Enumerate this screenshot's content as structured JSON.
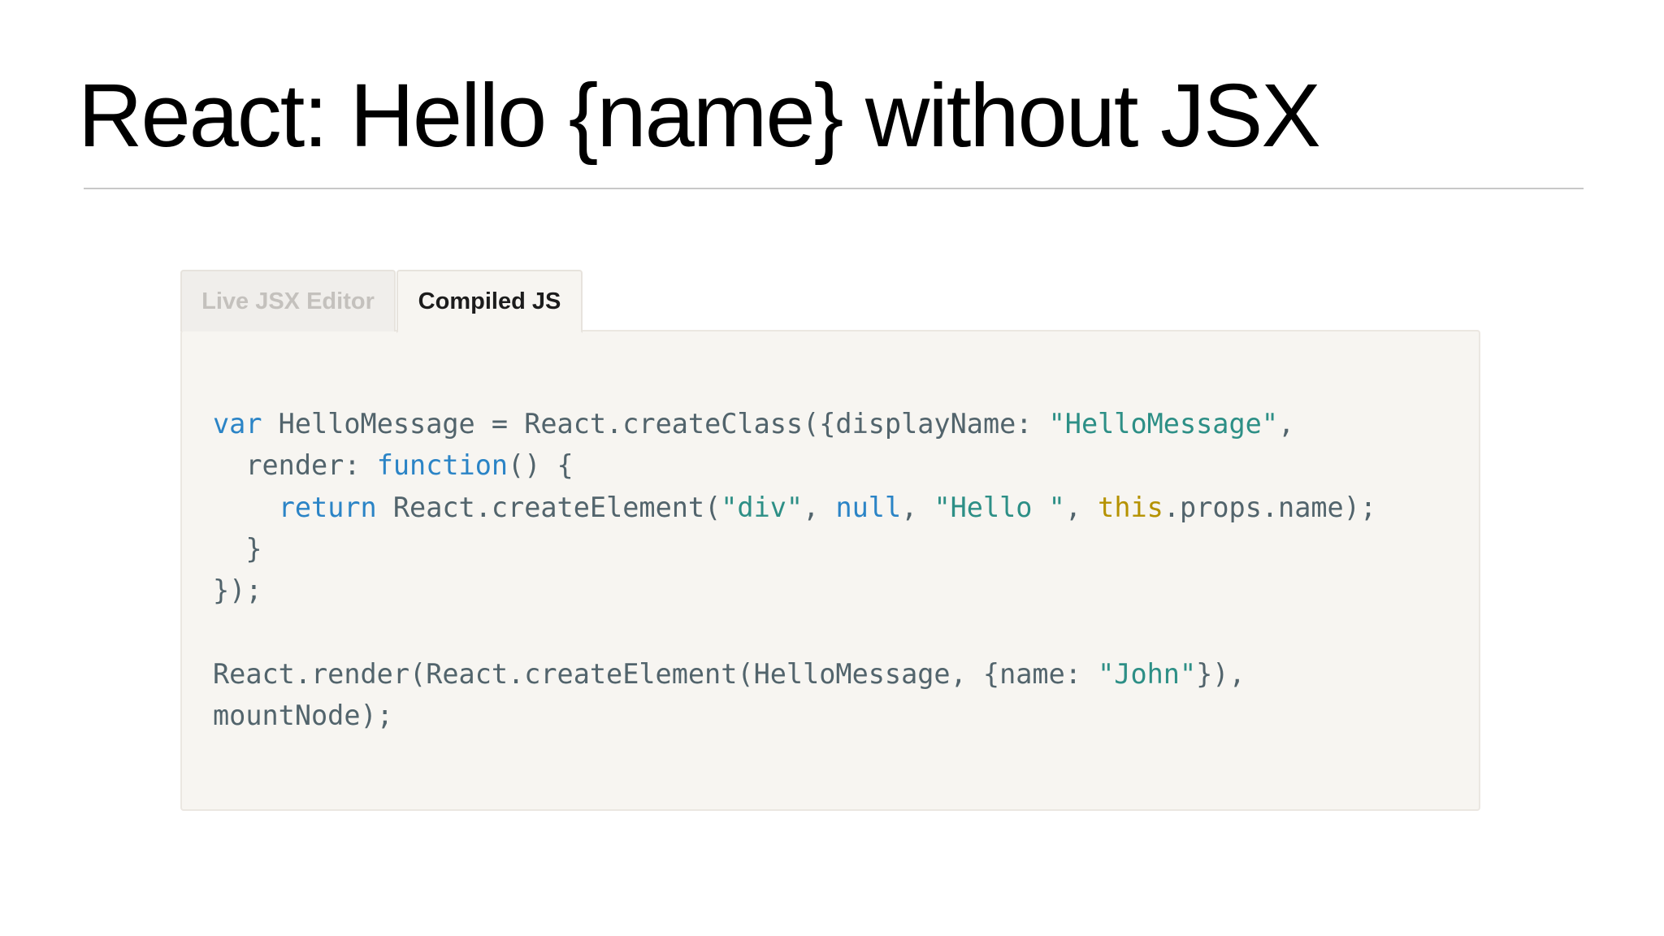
{
  "slide": {
    "title": "React: Hello {name} without JSX"
  },
  "tabs": [
    {
      "label": "Live JSX Editor",
      "active": false
    },
    {
      "label": "Compiled JS",
      "active": true
    }
  ],
  "code": {
    "line1": {
      "kw_var": "var",
      "mid": " HelloMessage = React.createClass({displayName: ",
      "str": "\"HelloMessage\"",
      "end": ","
    },
    "line2": {
      "indent": "  render: ",
      "kw_function": "function",
      "end": "() {"
    },
    "line3": {
      "indent": "    ",
      "kw_return": "return",
      "mid1": " React.createElement(",
      "str_div": "\"div\"",
      "comma1": ", ",
      "kw_null": "null",
      "comma2": ", ",
      "str_hello": "\"Hello \"",
      "comma3": ", ",
      "kw_this": "this",
      "end": ".props.name);"
    },
    "line4": "  }",
    "line5": "});",
    "line6": "",
    "line7": {
      "start": "React.render(React.createElement(HelloMessage, {name: ",
      "str_john": "\"John\"",
      "end": "}),"
    },
    "line8": "mountNode);"
  },
  "colors": {
    "keyword": "#2b84c6",
    "string": "#2d8f86",
    "this_keyword": "#b59200",
    "plain": "#52646c",
    "panel_background": "#f7f5f1"
  }
}
